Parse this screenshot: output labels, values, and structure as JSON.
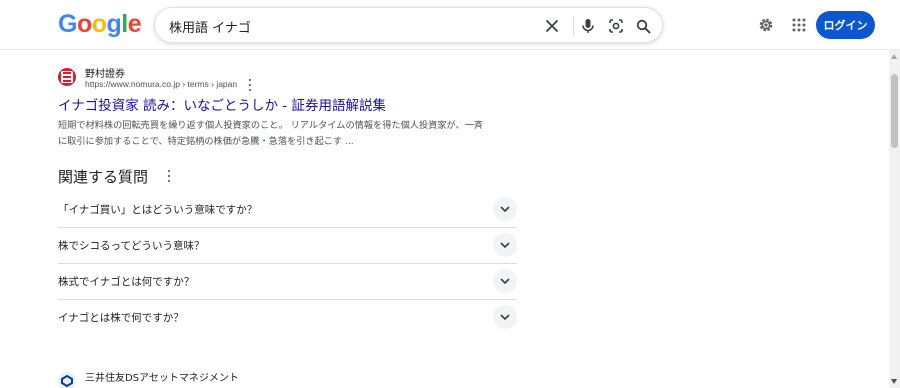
{
  "header": {
    "logo_letters": [
      {
        "char": "G",
        "color": "#4285F4"
      },
      {
        "char": "o",
        "color": "#EA4335"
      },
      {
        "char": "o",
        "color": "#FBBC05"
      },
      {
        "char": "g",
        "color": "#4285F4"
      },
      {
        "char": "l",
        "color": "#34A853"
      },
      {
        "char": "e",
        "color": "#EA4335"
      }
    ],
    "search_query": "株用語 イナゴ",
    "login_label": "ログイン",
    "icons": [
      "close-icon",
      "microphone-icon",
      "lens-icon",
      "search-icon",
      "settings-gear-icon",
      "apps-grid-icon"
    ]
  },
  "result1": {
    "site_name": "野村證券",
    "site_url": "https://www.nomura.co.jp › terms › japan",
    "title": "イナゴ投資家 読み：いなごとうしか - 証券用語解説集",
    "snippet_line1": "短期で材料株の回転売買を繰り返す個人投資家のこと。 リアルタイムの情報を得た個人投資家が、一斉",
    "snippet_line2": "に取引に参加することで、特定銘柄の株価が急騰・急落を引き起こす ..."
  },
  "paa": {
    "heading": "関連する質問",
    "questions": [
      "「イナゴ買い」とはどういう意味ですか？",
      "株でシコるってどういう意味？",
      "株式でイナゴとは何ですか？",
      "イナゴとは株で何ですか？"
    ]
  },
  "result2": {
    "site_name": "三井住友DSアセットマネジメント"
  },
  "colors": {
    "link": "#1a0dab",
    "accent_button": "#0b57d0",
    "text_secondary": "#4d5156"
  }
}
